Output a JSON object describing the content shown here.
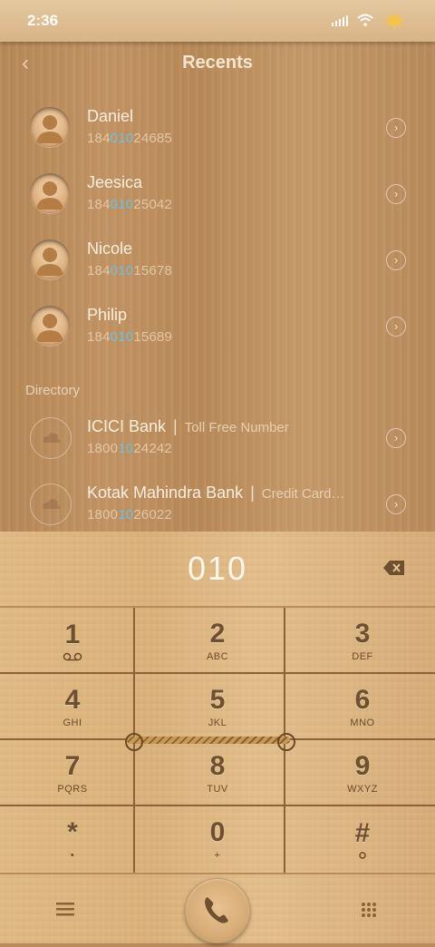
{
  "status": {
    "time": "2:36"
  },
  "header": {
    "title": "Recents"
  },
  "recents": [
    {
      "name": "Daniel",
      "pre": "184",
      "match": "010",
      "post": "24685"
    },
    {
      "name": "Jeesica",
      "pre": "184",
      "match": "010",
      "post": "25042"
    },
    {
      "name": "Nicole",
      "pre": "184",
      "match": "010",
      "post": "15678"
    },
    {
      "name": "Philip",
      "pre": "184",
      "match": "010",
      "post": "15689"
    }
  ],
  "directory": {
    "label": "Directory",
    "items": [
      {
        "name": "ICICI Bank",
        "tag": "Toll Free Number",
        "pre": "1800",
        "match": "10",
        "post": "24242"
      },
      {
        "name": "Kotak Mahindra Bank",
        "tag": "Credit Card…",
        "pre": "1800",
        "match": "10",
        "post": "26022"
      }
    ]
  },
  "dialer": {
    "input": "010"
  },
  "keys": [
    {
      "digit": "1",
      "letters": ""
    },
    {
      "digit": "2",
      "letters": "ABC"
    },
    {
      "digit": "3",
      "letters": "DEF"
    },
    {
      "digit": "4",
      "letters": "GHI"
    },
    {
      "digit": "5",
      "letters": "JKL"
    },
    {
      "digit": "6",
      "letters": "MNO"
    },
    {
      "digit": "7",
      "letters": "PQRS"
    },
    {
      "digit": "8",
      "letters": "TUV"
    },
    {
      "digit": "9",
      "letters": "WXYZ"
    },
    {
      "digit": "*",
      "letters": "•"
    },
    {
      "digit": "0",
      "letters": "+"
    },
    {
      "digit": "#",
      "letters": ""
    }
  ],
  "icons": {
    "back": "chevron-left-icon",
    "voicemail": "voicemail-icon",
    "menu": "menu-icon",
    "call": "phone-icon",
    "keypad": "keypad-icon"
  },
  "colors": {
    "highlight": "#6ac0e0",
    "wood": "#c39464"
  }
}
